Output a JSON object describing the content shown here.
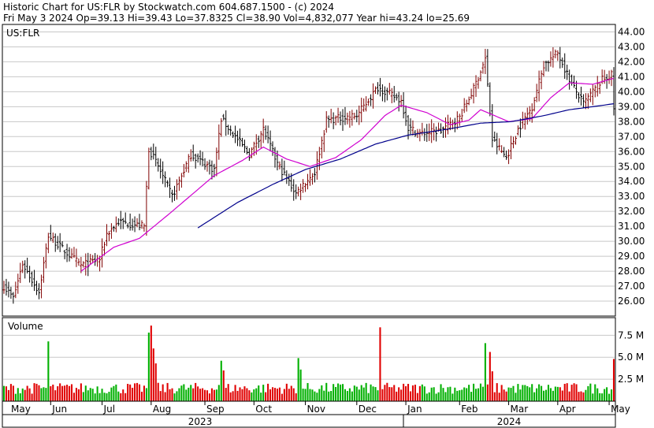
{
  "header": {
    "line1": "Historic Chart for US:FLR by Stockwatch.com 604.687.1500 - (c) 2024",
    "line2": "Fri May  3 2024  Op=39.13  Hi=39.43  Lo=37.8325  Cl=38.90  Vol=4,832,077  Year hi=43.24  lo=25.69"
  },
  "chart_data": [
    {
      "type": "ohlc",
      "symbol_label": "US:FLR",
      "ylim": [
        25,
        44.5
      ],
      "y_ticks": [
        "44.00",
        "43.00",
        "42.00",
        "41.00",
        "40.00",
        "39.00",
        "38.00",
        "37.00",
        "36.00",
        "35.00",
        "34.00",
        "33.00",
        "32.00",
        "31.00",
        "30.00",
        "29.00",
        "28.00",
        "27.00",
        "26.00"
      ],
      "x_months": [
        "May",
        "Jun",
        "Jul",
        "Aug",
        "Sep",
        "Oct",
        "Nov",
        "Dec",
        "Jan",
        "Feb",
        "Mar",
        "Apr",
        "May"
      ],
      "years": [
        "2023",
        "2024"
      ],
      "grid": true,
      "colors": {
        "up": "#800000",
        "down": "#000000",
        "ma_short": "#d000d0",
        "ma_long": "#00008b",
        "grid": "#c8c8c8"
      },
      "close_anchors": [
        {
          "date": "2023-05-04",
          "close": 27.0
        },
        {
          "date": "2023-05-10",
          "close": 26.2
        },
        {
          "date": "2023-05-16",
          "close": 28.5
        },
        {
          "date": "2023-05-25",
          "close": 26.6
        },
        {
          "date": "2023-05-31",
          "close": 30.4
        },
        {
          "date": "2023-06-08",
          "close": 29.5
        },
        {
          "date": "2023-06-20",
          "close": 28.4
        },
        {
          "date": "2023-06-30",
          "close": 28.8
        },
        {
          "date": "2023-07-05",
          "close": 30.5
        },
        {
          "date": "2023-07-12",
          "close": 31.3
        },
        {
          "date": "2023-07-27",
          "close": 31.0
        },
        {
          "date": "2023-07-31",
          "close": 36.2
        },
        {
          "date": "2023-08-04",
          "close": 35.0
        },
        {
          "date": "2023-08-14",
          "close": 33.0
        },
        {
          "date": "2023-08-24",
          "close": 35.8
        },
        {
          "date": "2023-09-07",
          "close": 34.8
        },
        {
          "date": "2023-09-12",
          "close": 38.2
        },
        {
          "date": "2023-09-22",
          "close": 36.6
        },
        {
          "date": "2023-09-28",
          "close": 35.8
        },
        {
          "date": "2023-10-06",
          "close": 37.5
        },
        {
          "date": "2023-10-16",
          "close": 35.2
        },
        {
          "date": "2023-10-26",
          "close": 33.2
        },
        {
          "date": "2023-10-31",
          "close": 33.8
        },
        {
          "date": "2023-11-07",
          "close": 34.6
        },
        {
          "date": "2023-11-14",
          "close": 38.1
        },
        {
          "date": "2023-12-01",
          "close": 38.4
        },
        {
          "date": "2023-12-14",
          "close": 40.3
        },
        {
          "date": "2023-12-28",
          "close": 39.4
        },
        {
          "date": "2024-01-02",
          "close": 37.6
        },
        {
          "date": "2024-01-09",
          "close": 37.2
        },
        {
          "date": "2024-01-22",
          "close": 37.4
        },
        {
          "date": "2024-02-01",
          "close": 38.3
        },
        {
          "date": "2024-02-09",
          "close": 40.2
        },
        {
          "date": "2024-02-16",
          "close": 42.2
        },
        {
          "date": "2024-02-21",
          "close": 36.8
        },
        {
          "date": "2024-02-29",
          "close": 35.6
        },
        {
          "date": "2024-03-07",
          "close": 37.5
        },
        {
          "date": "2024-03-15",
          "close": 39.0
        },
        {
          "date": "2024-03-22",
          "close": 41.8
        },
        {
          "date": "2024-04-01",
          "close": 42.6
        },
        {
          "date": "2024-04-09",
          "close": 40.5
        },
        {
          "date": "2024-04-16",
          "close": 39.2
        },
        {
          "date": "2024-04-26",
          "close": 40.8
        },
        {
          "date": "2024-05-02",
          "close": 41.1
        },
        {
          "date": "2024-05-03",
          "close": 38.9
        }
      ],
      "ma_short_anchors": [
        {
          "date": "2023-06-20",
          "value": 28.0
        },
        {
          "date": "2023-07-10",
          "value": 29.6
        },
        {
          "date": "2023-07-25",
          "value": 30.2
        },
        {
          "date": "2023-08-14",
          "value": 32.0
        },
        {
          "date": "2023-09-07",
          "value": 34.4
        },
        {
          "date": "2023-09-25",
          "value": 35.4
        },
        {
          "date": "2023-10-06",
          "value": 36.3
        },
        {
          "date": "2023-10-20",
          "value": 35.5
        },
        {
          "date": "2023-11-03",
          "value": 35.0
        },
        {
          "date": "2023-11-20",
          "value": 35.6
        },
        {
          "date": "2023-12-05",
          "value": 36.8
        },
        {
          "date": "2023-12-19",
          "value": 38.4
        },
        {
          "date": "2023-12-28",
          "value": 39.1
        },
        {
          "date": "2024-01-12",
          "value": 38.6
        },
        {
          "date": "2024-01-26",
          "value": 37.8
        },
        {
          "date": "2024-02-07",
          "value": 38.1
        },
        {
          "date": "2024-02-14",
          "value": 38.8
        },
        {
          "date": "2024-03-01",
          "value": 38.0
        },
        {
          "date": "2024-03-15",
          "value": 38.2
        },
        {
          "date": "2024-03-27",
          "value": 39.6
        },
        {
          "date": "2024-04-08",
          "value": 40.6
        },
        {
          "date": "2024-04-22",
          "value": 40.5
        },
        {
          "date": "2024-05-03",
          "value": 40.9
        }
      ],
      "ma_long_anchors": [
        {
          "date": "2023-08-29",
          "value": 30.9
        },
        {
          "date": "2023-09-21",
          "value": 32.6
        },
        {
          "date": "2023-10-12",
          "value": 33.8
        },
        {
          "date": "2023-11-01",
          "value": 34.8
        },
        {
          "date": "2023-11-22",
          "value": 35.5
        },
        {
          "date": "2023-12-13",
          "value": 36.5
        },
        {
          "date": "2024-01-02",
          "value": 37.1
        },
        {
          "date": "2024-01-25",
          "value": 37.5
        },
        {
          "date": "2024-02-14",
          "value": 37.9
        },
        {
          "date": "2024-03-04",
          "value": 38.0
        },
        {
          "date": "2024-03-22",
          "value": 38.4
        },
        {
          "date": "2024-04-08",
          "value": 38.8
        },
        {
          "date": "2024-04-22",
          "value": 39.0
        },
        {
          "date": "2024-05-03",
          "value": 39.2
        }
      ]
    },
    {
      "type": "bar",
      "title": "Volume",
      "ylim": [
        0,
        9.5
      ],
      "y_unit": "M",
      "y_ticks": [
        "7.5 M",
        "5.0 M",
        "2.5 M"
      ],
      "base_volume": 1.4,
      "spikes": [
        {
          "date": "2023-05-31",
          "volume": 6.8
        },
        {
          "date": "2023-07-31",
          "volume": 7.8
        },
        {
          "date": "2023-08-01",
          "volume": 8.6
        },
        {
          "date": "2023-08-02",
          "volume": 6.0
        },
        {
          "date": "2023-08-03",
          "volume": 4.3
        },
        {
          "date": "2023-09-12",
          "volume": 4.6
        },
        {
          "date": "2023-09-13",
          "volume": 3.5
        },
        {
          "date": "2023-10-27",
          "volume": 4.9
        },
        {
          "date": "2023-10-30",
          "volume": 3.6
        },
        {
          "date": "2023-12-15",
          "volume": 8.4
        },
        {
          "date": "2024-02-16",
          "volume": 6.6
        },
        {
          "date": "2024-02-20",
          "volume": 5.6
        },
        {
          "date": "2024-02-21",
          "volume": 3.4
        },
        {
          "date": "2024-05-03",
          "volume": 4.8
        }
      ]
    }
  ]
}
